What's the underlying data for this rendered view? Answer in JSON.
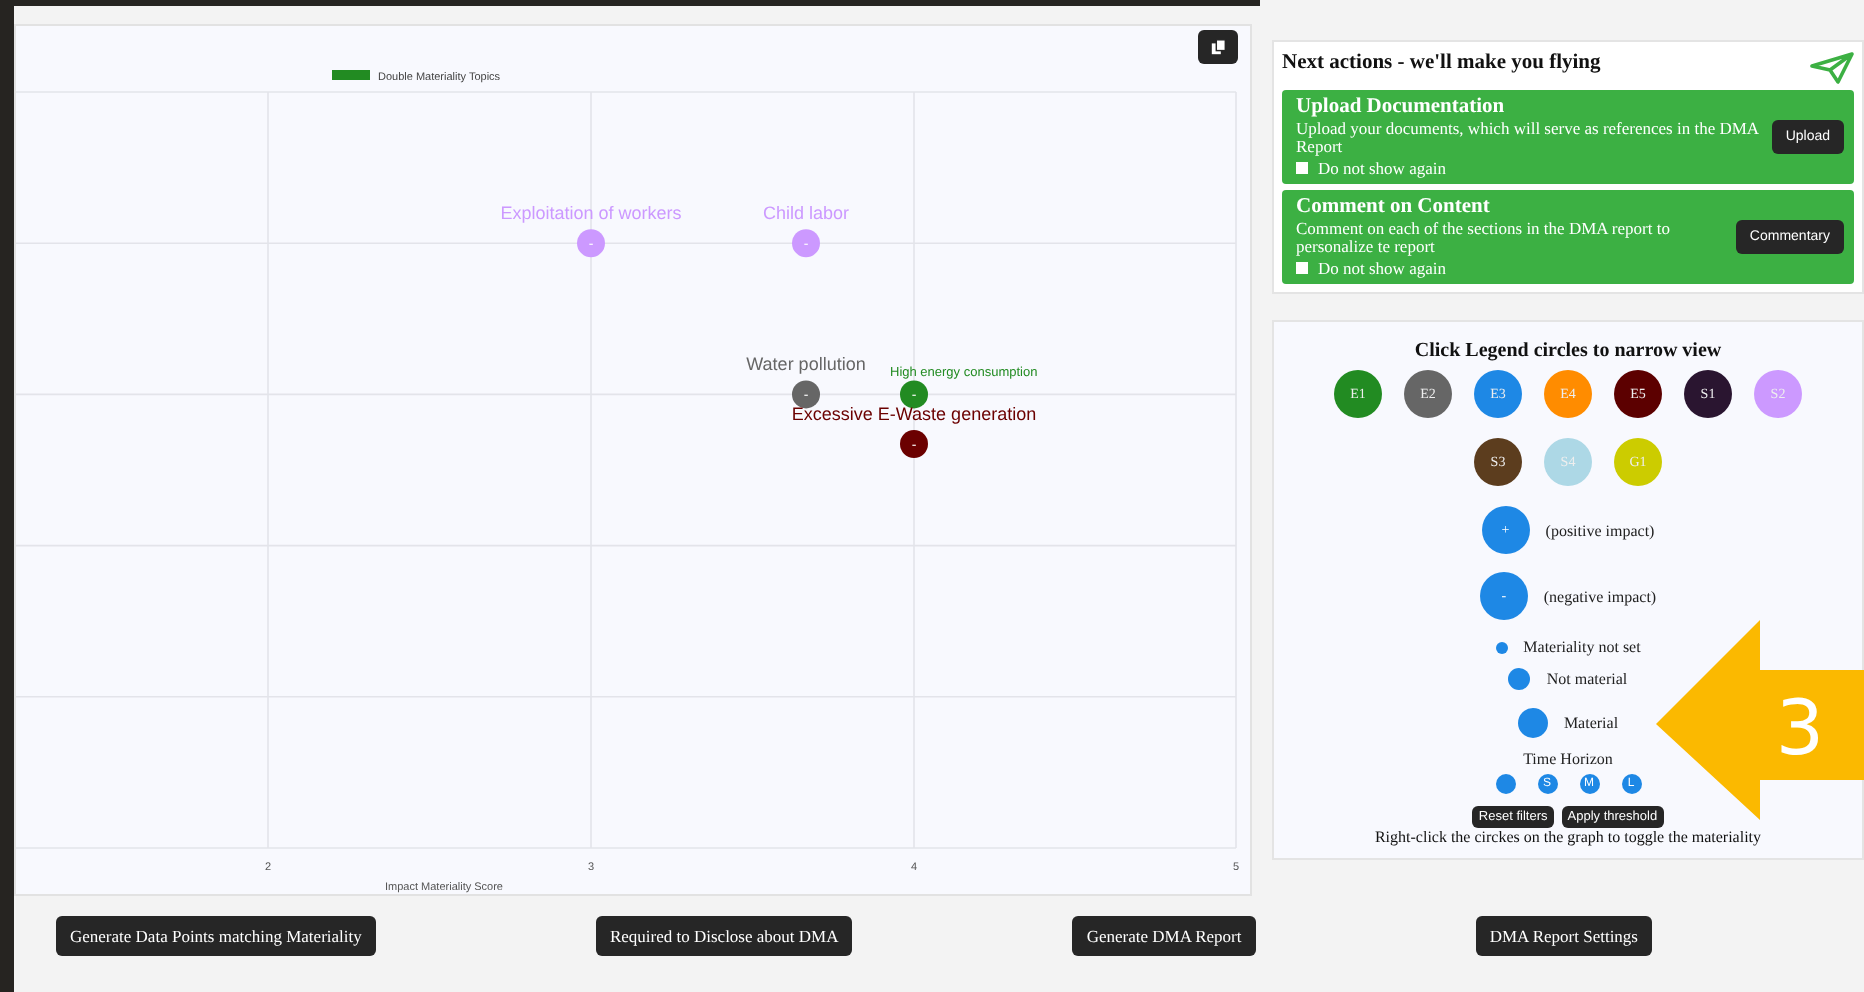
{
  "chart": {
    "legend": {
      "label": "Double Materiality Topics",
      "color": "#228b22"
    },
    "x_axis_title": "Impact Materiality Score",
    "x_ticks": [
      "2",
      "3",
      "4",
      "5"
    ],
    "points": [
      {
        "label": "Exploitation of workers",
        "sign": "-",
        "color": "#cc99ff"
      },
      {
        "label": "Child labor",
        "sign": "-",
        "color": "#cc99ff"
      },
      {
        "label": "Water pollution",
        "sign": "-",
        "color": "#666666"
      },
      {
        "label": "High energy consumption",
        "sign": "-",
        "color": "#228b22",
        "kind": "small"
      },
      {
        "label": "Excessive E-Waste generation",
        "sign": "-",
        "color": "#6b0000"
      }
    ]
  },
  "next_actions": {
    "title": "Next actions - we'll make you flying",
    "cards": [
      {
        "title": "Upload Documentation",
        "text": "Upload your documents, which will serve as references in the DMA Report",
        "checkbox": "Do not show again",
        "checked": false,
        "button": "Upload"
      },
      {
        "title": "Comment on Content",
        "text": "Comment on each of the sections in the DMA report to personalize te report",
        "checkbox": "Do not show again",
        "checked": false,
        "button": "Commentary"
      }
    ]
  },
  "legend": {
    "title": "Click Legend circles to narrow view",
    "topics": [
      {
        "label": "E1",
        "color": "#228b22"
      },
      {
        "label": "E2",
        "color": "#666666"
      },
      {
        "label": "E3",
        "color": "#1e88e5"
      },
      {
        "label": "E4",
        "color": "#ff8c00"
      },
      {
        "label": "E5",
        "color": "#5c0000"
      },
      {
        "label": "S1",
        "color": "#2a1530"
      },
      {
        "label": "S2",
        "color": "#cc99ff"
      },
      {
        "label": "S3",
        "color": "#5c3d1e"
      },
      {
        "label": "S4",
        "color": "#add8e6"
      },
      {
        "label": "G1",
        "color": "#cccc00"
      }
    ],
    "impacts": [
      {
        "sign": "+",
        "label": "(positive impact)"
      },
      {
        "sign": "-",
        "label": "(negative impact)"
      }
    ],
    "materiality": [
      {
        "kind": "small",
        "label": "Materiality not set"
      },
      {
        "kind": "medium",
        "label": "Not material"
      },
      {
        "kind": "large",
        "label": "Material"
      }
    ],
    "time_horizon": {
      "title": "Time Horizon",
      "options": [
        {
          "kind": "all"
        },
        {
          "kind": "letter",
          "label": "S"
        },
        {
          "kind": "letter",
          "label": "M"
        },
        {
          "kind": "letter",
          "label": "L"
        }
      ]
    },
    "buttons": [
      "Reset filters",
      "Apply threshold"
    ],
    "hint": "Right-click the circkes on the graph to toggle the materiality"
  },
  "callout": {
    "number": "3"
  },
  "bottom_buttons": [
    "Generate Data Points matching Materiality",
    "Required to Disclose about DMA",
    "Generate DMA Report",
    "DMA Report Settings"
  ]
}
